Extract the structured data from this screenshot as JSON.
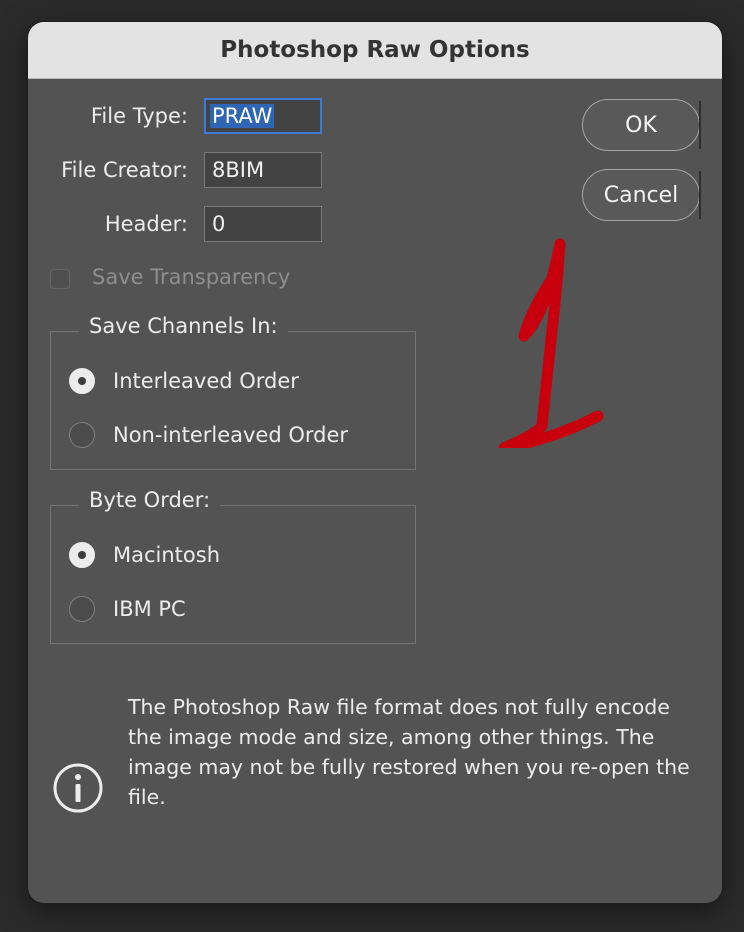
{
  "dialog": {
    "title": "Photoshop Raw Options"
  },
  "fields": {
    "file_type_label": "File Type:",
    "file_type_value": "PRAW",
    "file_creator_label": "File Creator:",
    "file_creator_value": "8BIM",
    "header_label": "Header:",
    "header_value": "0"
  },
  "buttons": {
    "ok": "OK",
    "cancel": "Cancel"
  },
  "save_transparency": {
    "label": "Save Transparency",
    "checked": false,
    "enabled": false
  },
  "save_channels": {
    "title": "Save Channels In:",
    "options": [
      "Interleaved Order",
      "Non-interleaved Order"
    ],
    "selected": "Interleaved Order"
  },
  "byte_order": {
    "title": "Byte Order:",
    "options": [
      "Macintosh",
      "IBM PC"
    ],
    "selected": "Macintosh"
  },
  "info": {
    "icon": "info-icon",
    "text": "The Photoshop Raw file format does not fully encode the image mode and size, among other things.  The image may not be fully restored when you re-open the file."
  },
  "colors": {
    "dialog_bg": "#535353",
    "titlebar_bg": "#e3e3e3",
    "focus_ring": "#3b7bd6",
    "annotation": "#c8000e"
  }
}
